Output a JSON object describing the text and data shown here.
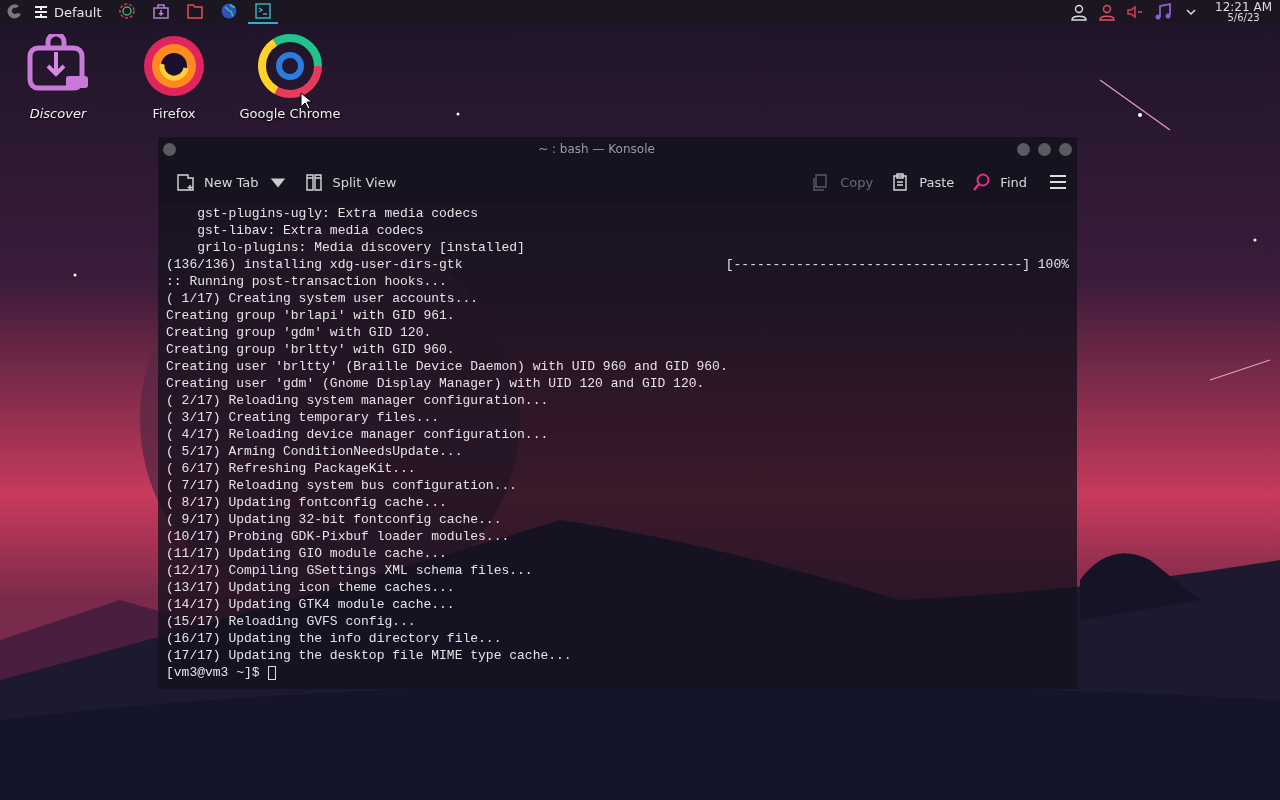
{
  "panel": {
    "layout_label": "Default",
    "launchers": [
      {
        "kind": "gear",
        "selected": false
      },
      {
        "kind": "package",
        "selected": false
      },
      {
        "kind": "folder",
        "selected": false
      },
      {
        "kind": "globe",
        "selected": false
      },
      {
        "kind": "terminal",
        "selected": true
      }
    ],
    "tray": [
      {
        "kind": "user"
      },
      {
        "kind": "user-alert"
      },
      {
        "kind": "volume-muted"
      },
      {
        "kind": "music"
      },
      {
        "kind": "chevron"
      }
    ],
    "clock": {
      "time": "12:21 AM",
      "date": "5/6/23"
    }
  },
  "desktop_icons": [
    {
      "label": "Discover",
      "kind": "discover",
      "hovered": true
    },
    {
      "label": "Firefox",
      "kind": "firefox",
      "hovered": false
    },
    {
      "label": "Google Chrome",
      "kind": "chrome",
      "hovered": false
    }
  ],
  "window": {
    "title": "~ : bash — Konsole",
    "toolbar_left": [
      {
        "label": "New Tab",
        "kind": "new-tab",
        "disabled": false,
        "dropdown": true
      },
      {
        "label": "Split View",
        "kind": "split-view",
        "disabled": false,
        "dropdown": false
      }
    ],
    "toolbar_right": [
      {
        "label": "Copy",
        "kind": "copy",
        "disabled": true
      },
      {
        "label": "Paste",
        "kind": "paste",
        "disabled": false
      },
      {
        "label": "Find",
        "kind": "find",
        "disabled": false
      }
    ],
    "terminal": {
      "lines": [
        {
          "kind": "text",
          "text": "    gst-plugins-ugly: Extra media codecs"
        },
        {
          "kind": "text",
          "text": "    gst-libav: Extra media codecs"
        },
        {
          "kind": "text",
          "text": "    grilo-plugins: Media discovery [installed]"
        },
        {
          "kind": "progress",
          "text": "(136/136) installing xdg-user-dirs-gtk",
          "bar": "[-------------------------------------] 100%"
        },
        {
          "kind": "text",
          "text": ":: Running post-transaction hooks..."
        },
        {
          "kind": "text",
          "text": "( 1/17) Creating system user accounts..."
        },
        {
          "kind": "text",
          "text": "Creating group 'brlapi' with GID 961."
        },
        {
          "kind": "text",
          "text": "Creating group 'gdm' with GID 120."
        },
        {
          "kind": "text",
          "text": "Creating group 'brltty' with GID 960."
        },
        {
          "kind": "text",
          "text": "Creating user 'brltty' (Braille Device Daemon) with UID 960 and GID 960."
        },
        {
          "kind": "text",
          "text": "Creating user 'gdm' (Gnome Display Manager) with UID 120 and GID 120."
        },
        {
          "kind": "text",
          "text": "( 2/17) Reloading system manager configuration..."
        },
        {
          "kind": "text",
          "text": "( 3/17) Creating temporary files..."
        },
        {
          "kind": "text",
          "text": "( 4/17) Reloading device manager configuration..."
        },
        {
          "kind": "text",
          "text": "( 5/17) Arming ConditionNeedsUpdate..."
        },
        {
          "kind": "text",
          "text": "( 6/17) Refreshing PackageKit..."
        },
        {
          "kind": "text",
          "text": "( 7/17) Reloading system bus configuration..."
        },
        {
          "kind": "text",
          "text": "( 8/17) Updating fontconfig cache..."
        },
        {
          "kind": "text",
          "text": "( 9/17) Updating 32-bit fontconfig cache..."
        },
        {
          "kind": "text",
          "text": "(10/17) Probing GDK-Pixbuf loader modules..."
        },
        {
          "kind": "text",
          "text": "(11/17) Updating GIO module cache..."
        },
        {
          "kind": "text",
          "text": "(12/17) Compiling GSettings XML schema files..."
        },
        {
          "kind": "text",
          "text": "(13/17) Updating icon theme caches..."
        },
        {
          "kind": "text",
          "text": "(14/17) Updating GTK4 module cache..."
        },
        {
          "kind": "text",
          "text": "(15/17) Reloading GVFS config..."
        },
        {
          "kind": "text",
          "text": "(16/17) Updating the info directory file..."
        },
        {
          "kind": "text",
          "text": "(17/17) Updating the desktop file MIME type cache..."
        }
      ],
      "prompt": "[vm3@vm3 ~]$"
    }
  }
}
